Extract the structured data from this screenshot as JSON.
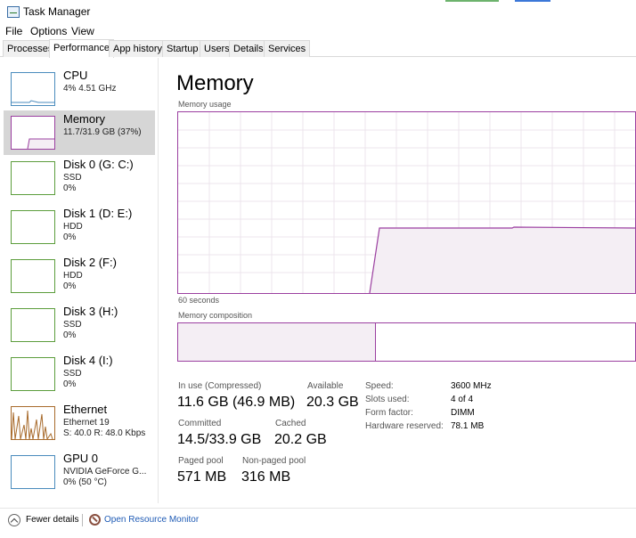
{
  "window": {
    "title": "Task Manager"
  },
  "menu": [
    "File",
    "Options",
    "View"
  ],
  "tabs": [
    "Processes",
    "Performance",
    "App history",
    "Startup",
    "Users",
    "Details",
    "Services"
  ],
  "sidebar": {
    "items": [
      {
        "name": "CPU",
        "sub": "4% 4.51 GHz",
        "sub2": ""
      },
      {
        "name": "Memory",
        "sub": "11.7/31.9 GB (37%)",
        "sub2": ""
      },
      {
        "name": "Disk 0 (G: C:)",
        "sub": "SSD",
        "sub2": "0%"
      },
      {
        "name": "Disk 1 (D: E:)",
        "sub": "HDD",
        "sub2": "0%"
      },
      {
        "name": "Disk 2 (F:)",
        "sub": "HDD",
        "sub2": "0%"
      },
      {
        "name": "Disk 3 (H:)",
        "sub": "SSD",
        "sub2": "0%"
      },
      {
        "name": "Disk 4 (I:)",
        "sub": "SSD",
        "sub2": "0%"
      },
      {
        "name": "Ethernet",
        "sub": "Ethernet 19",
        "sub2": "S: 40.0  R: 48.0 Kbps"
      },
      {
        "name": "GPU 0",
        "sub": "NVIDIA GeForce G...",
        "sub2": "0% (50 °C)"
      }
    ]
  },
  "main": {
    "title": "Memory",
    "usage_label": "Memory usage",
    "time_label": "60 seconds",
    "composition_label": "Memory composition",
    "usage_fraction": 0.37,
    "composition_in_use_fraction": 0.43
  },
  "stats": {
    "in_use_label": "In use (Compressed)",
    "in_use_value": "11.6 GB (46.9 MB)",
    "available_label": "Available",
    "available_value": "20.3 GB",
    "committed_label": "Committed",
    "committed_value": "14.5/33.9 GB",
    "cached_label": "Cached",
    "cached_value": "20.2 GB",
    "paged_label": "Paged pool",
    "paged_value": "571 MB",
    "nonpaged_label": "Non-paged pool",
    "nonpaged_value": "316 MB"
  },
  "props": [
    {
      "label": "Speed:",
      "value": "3600 MHz"
    },
    {
      "label": "Slots used:",
      "value": "4 of 4"
    },
    {
      "label": "Form factor:",
      "value": "DIMM"
    },
    {
      "label": "Hardware reserved:",
      "value": "78.1 MB"
    }
  ],
  "footer": {
    "fewer_details": "Fewer details",
    "open_monitor": "Open Resource Monitor"
  },
  "colors": {
    "memory_accent": "#9b3fa0",
    "memory_fill": "#f4eef4",
    "selection": "#d6d6d6",
    "link": "#1f5bb5"
  },
  "icons": {
    "app": "task-manager-icon",
    "fewer": "chevron-up-circle-icon",
    "monitor": "resource-monitor-icon"
  }
}
